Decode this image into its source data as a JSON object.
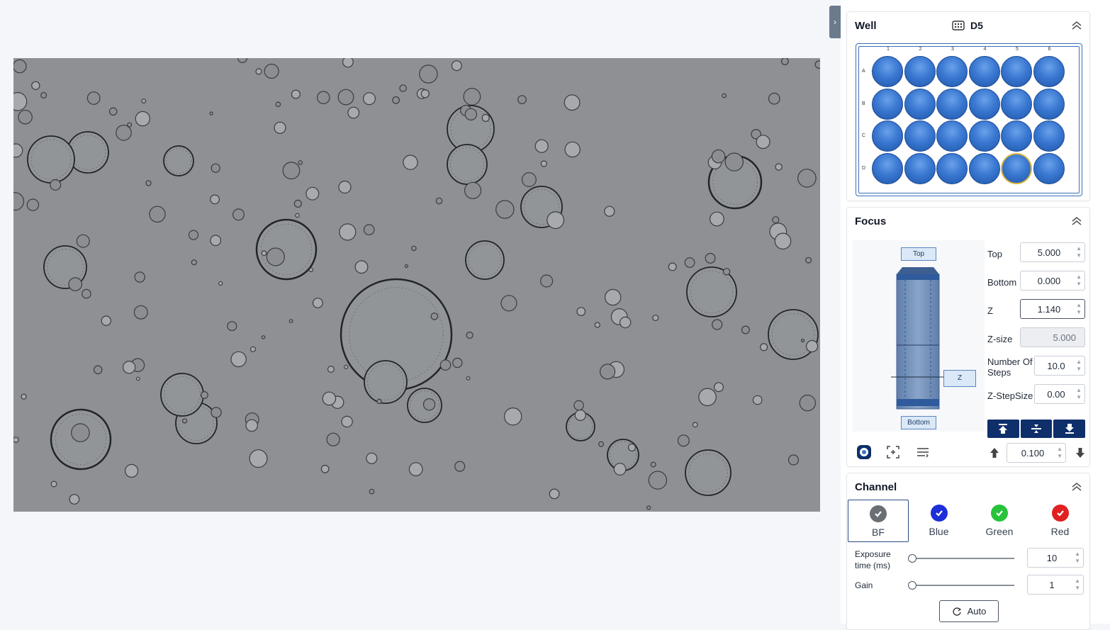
{
  "well_panel": {
    "title": "Well",
    "selected_well": "D5",
    "columns": [
      "1",
      "2",
      "3",
      "4",
      "5",
      "6"
    ],
    "rows": [
      "A",
      "B",
      "C",
      "D"
    ],
    "selected_index": 22
  },
  "focus_panel": {
    "title": "Focus",
    "top_btn": "Top",
    "bottom_btn": "Bottom",
    "z_btn": "Z",
    "fields": {
      "top_label": "Top",
      "top_value": "5.000",
      "bottom_label": "Bottom",
      "bottom_value": "0.000",
      "z_label": "Z",
      "z_value": "1.140",
      "zsize_label": "Z-size",
      "zsize_value": "5.000",
      "steps_label": "Number Of Steps",
      "steps_value": "10.0",
      "stepsize_label": "Z-StepSize",
      "stepsize_value": "0.00"
    },
    "step_value": "0.100"
  },
  "channel_panel": {
    "title": "Channel",
    "channels": [
      {
        "name": "BF",
        "color": "#6b6f75",
        "selected": true
      },
      {
        "name": "Blue",
        "color": "#1d2fd8",
        "selected": false
      },
      {
        "name": "Green",
        "color": "#27c33a",
        "selected": false
      },
      {
        "name": "Red",
        "color": "#e02121",
        "selected": false
      }
    ],
    "exposure_label": "Exposure time (ms)",
    "exposure_value": "10",
    "gain_label": "Gain",
    "gain_value": "1",
    "auto_label": "Auto"
  }
}
